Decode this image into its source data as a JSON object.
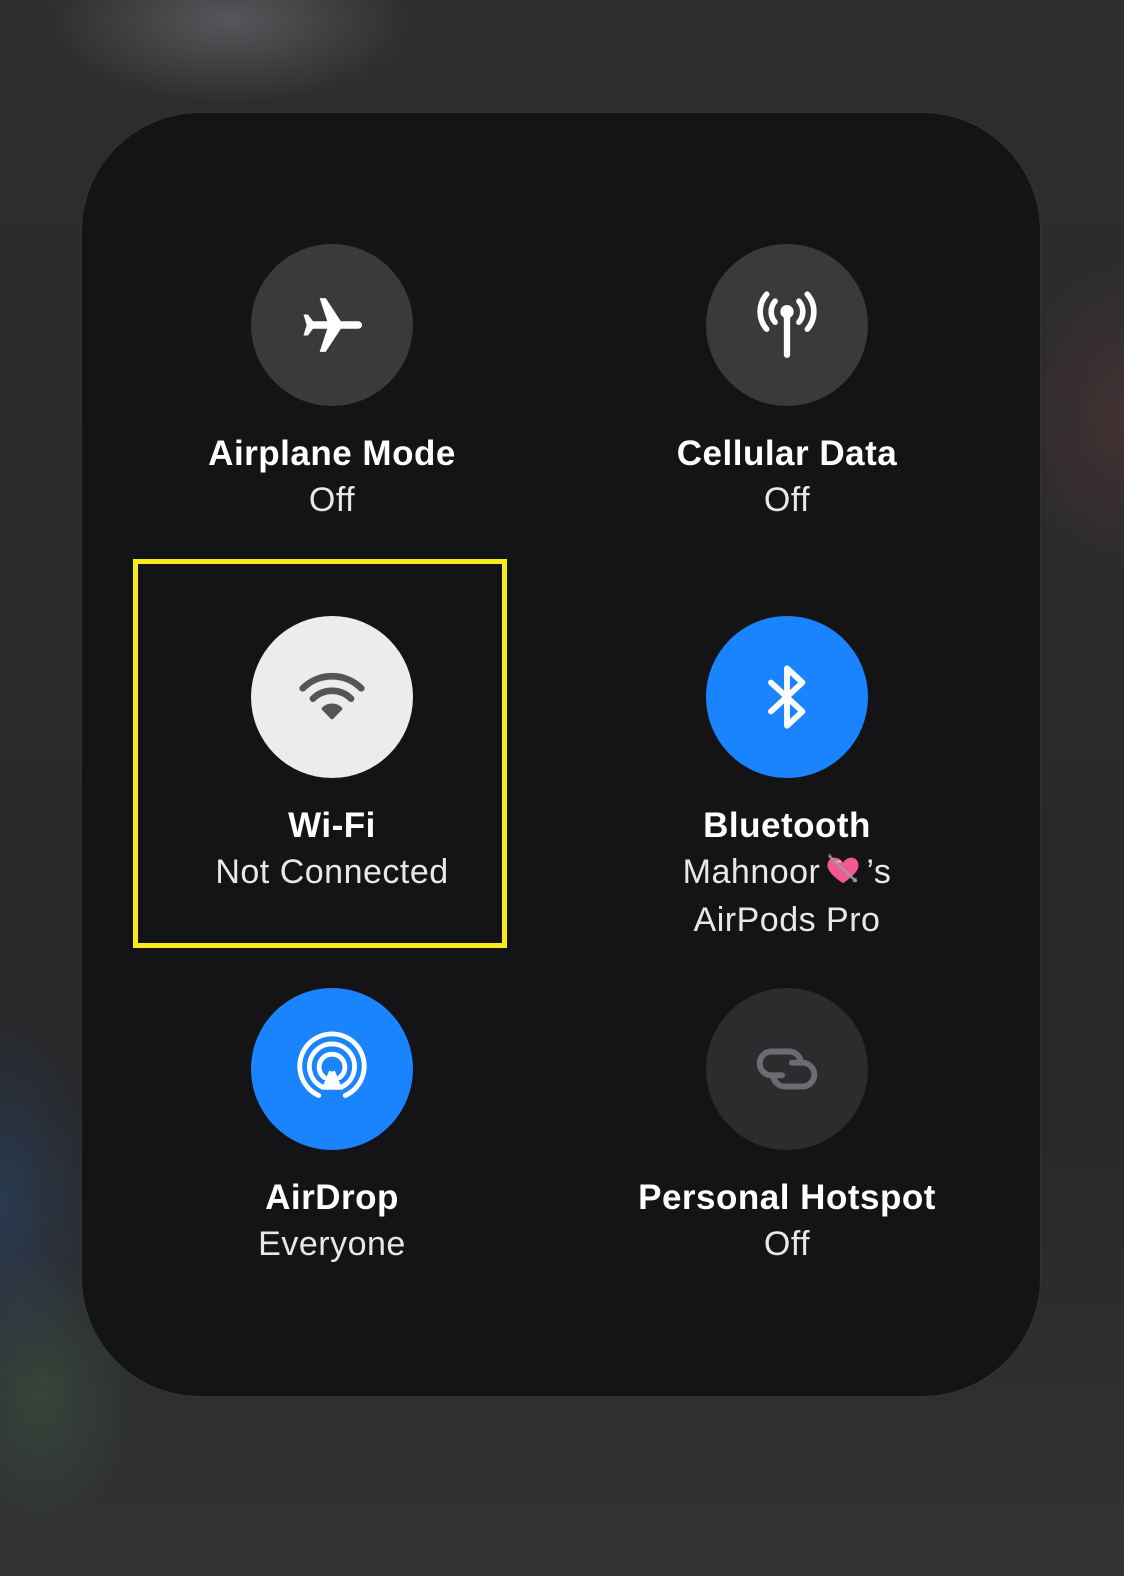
{
  "panel": {
    "tiles": [
      {
        "id": "airplane",
        "title": "Airplane Mode",
        "status": "Off",
        "icon": "airplane-icon",
        "state": "off"
      },
      {
        "id": "cellular",
        "title": "Cellular Data",
        "status": "Off",
        "icon": "antenna-icon",
        "state": "off"
      },
      {
        "id": "wifi",
        "title": "Wi-Fi",
        "status": "Not Connected",
        "icon": "wifi-icon",
        "state": "on-not-connected"
      },
      {
        "id": "bluetooth",
        "title": "Bluetooth",
        "status_line1_name": "Mahnoor",
        "status_line1_suffix": "’s",
        "status_line1_emoji": "heart-with-arrow-emoji",
        "status_line2": "AirPods Pro",
        "icon": "bluetooth-icon",
        "state": "on"
      },
      {
        "id": "airdrop",
        "title": "AirDrop",
        "status": "Everyone",
        "icon": "airdrop-icon",
        "state": "on"
      },
      {
        "id": "hotspot",
        "title": "Personal Hotspot",
        "status": "Off",
        "icon": "hotspot-link-icon",
        "state": "disabled"
      }
    ]
  },
  "highlight": {
    "target": "wifi",
    "color": "#f6ec1c"
  },
  "colors": {
    "active_blue": "#1a84ff",
    "off_circle": "#3a3a3c",
    "panel_bg": "#141416"
  }
}
